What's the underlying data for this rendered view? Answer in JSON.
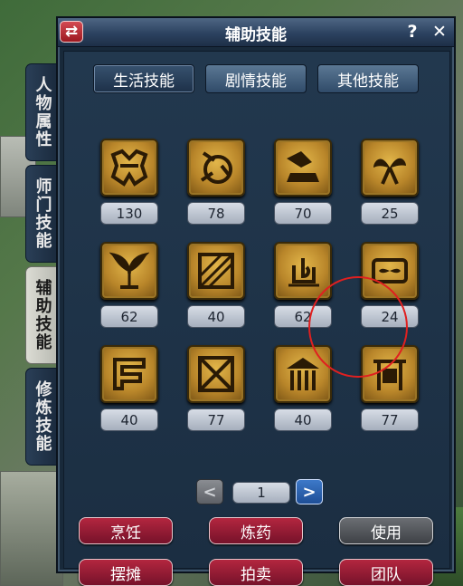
{
  "window": {
    "title": "辅助技能",
    "help_label": "?",
    "close_label": "✕",
    "swap_label": "⇄"
  },
  "side_tabs": [
    {
      "label": "人物属性",
      "active": false
    },
    {
      "label": "师门技能",
      "active": false
    },
    {
      "label": "辅助技能",
      "active": true
    },
    {
      "label": "修炼技能",
      "active": false
    }
  ],
  "category_tabs": [
    {
      "label": "生活技能",
      "active": true
    },
    {
      "label": "剧情技能",
      "active": false
    },
    {
      "label": "其他技能",
      "active": false
    }
  ],
  "skills": [
    {
      "level": "130",
      "icon": "cooking-skill-icon"
    },
    {
      "level": "78",
      "icon": "alchemy-skill-icon"
    },
    {
      "level": "70",
      "icon": "forging-skill-icon"
    },
    {
      "level": "25",
      "icon": "tailoring-skill-icon"
    },
    {
      "level": "62",
      "icon": "herbalism-skill-icon"
    },
    {
      "level": "40",
      "icon": "carpentry-skill-icon"
    },
    {
      "level": "62",
      "icon": "meditation-skill-icon",
      "highlighted": true
    },
    {
      "level": "24",
      "icon": "strengthen-skill-icon"
    },
    {
      "level": "40",
      "icon": "fitness-skill-icon"
    },
    {
      "level": "77",
      "icon": "divination-skill-icon"
    },
    {
      "level": "40",
      "icon": "temple-skill-icon"
    },
    {
      "level": "77",
      "icon": "merchant-skill-icon"
    }
  ],
  "pagination": {
    "current_page": "1",
    "prev_label": "<",
    "next_label": ">"
  },
  "actions": [
    {
      "label": "烹饪",
      "style": "red"
    },
    {
      "label": "炼药",
      "style": "red"
    },
    {
      "label": "使用",
      "style": "grey"
    },
    {
      "label": "摆摊",
      "style": "red"
    },
    {
      "label": "拍卖",
      "style": "red"
    },
    {
      "label": "团队",
      "style": "red"
    }
  ],
  "colors": {
    "window_bg": "#18293a",
    "action_red": "#a01f37",
    "skill_gold": "#c9952f",
    "highlight": "#e02020"
  }
}
